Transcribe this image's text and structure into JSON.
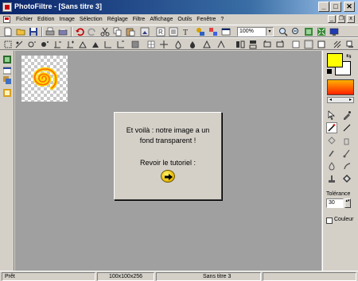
{
  "window": {
    "title": "PhotoFiltre - [Sans titre 3]",
    "minimize_glyph": "_",
    "maximize_glyph": "□",
    "close_glyph": "✕"
  },
  "menu": {
    "items": [
      "Fichier",
      "Edition",
      "Image",
      "Sélection",
      "Réglage",
      "Filtre",
      "Affichage",
      "Outils",
      "Fenêtre",
      "?"
    ],
    "mdi_minimize_glyph": "_",
    "mdi_restore_glyph": "❐",
    "mdi_close_glyph": "x"
  },
  "toolbar": {
    "zoom_value": "100%",
    "zoom_arrow": "▾"
  },
  "dialog": {
    "line1": "Et voilà : notre image a un",
    "line2": "fond transparent !",
    "tutorial_label": "Revoir le tutoriel :"
  },
  "right_panel": {
    "swap_glyph": "⇆",
    "scroll_left": "◂",
    "scroll_right": "▸",
    "tolerance_label": "Tolérance",
    "tolerance_value": "30",
    "spin_glyph": "▴▾",
    "couleur_label": "Couleur"
  },
  "status": {
    "left": "Prêt",
    "dimensions": "100x100x256",
    "doc_name": "Sans titre 3"
  },
  "colors": {
    "foreground": "#ffff00",
    "background": "#ffffff",
    "gradient_start": "#ffb000",
    "gradient_end": "#ff2000",
    "workspace": "#a0a0a0",
    "titlebar": "#0a246a"
  }
}
